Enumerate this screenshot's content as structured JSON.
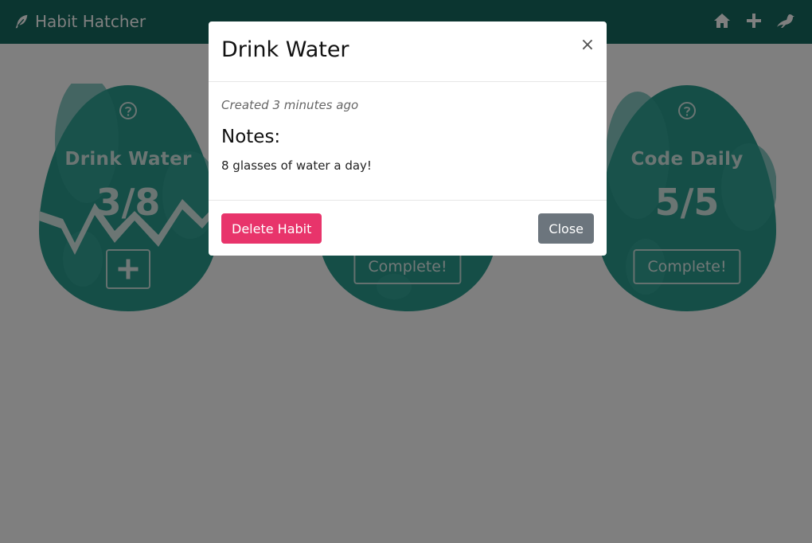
{
  "navbar": {
    "brand": "Habit Hatcher",
    "icons": [
      "feather-icon",
      "home-icon",
      "plus-icon",
      "bird-icon"
    ]
  },
  "habits": [
    {
      "title": "Drink Water",
      "count": "3/8",
      "action": "+"
    },
    {
      "title": "",
      "count": "",
      "action_label": "Complete!"
    },
    {
      "title": "Code Daily",
      "count": "5/5",
      "action_label": "Complete!"
    }
  ],
  "modal": {
    "title": "Drink Water",
    "close_symbol": "×",
    "created": "Created 3 minutes ago",
    "notes_heading": "Notes:",
    "notes_text": "8 glasses of water a day!",
    "delete_label": "Delete Habit",
    "close_label": "Close"
  },
  "colors": {
    "navbar": "#176b60",
    "egg": "#2a9d8f",
    "delete": "#e8346b",
    "close": "#6c757d"
  }
}
